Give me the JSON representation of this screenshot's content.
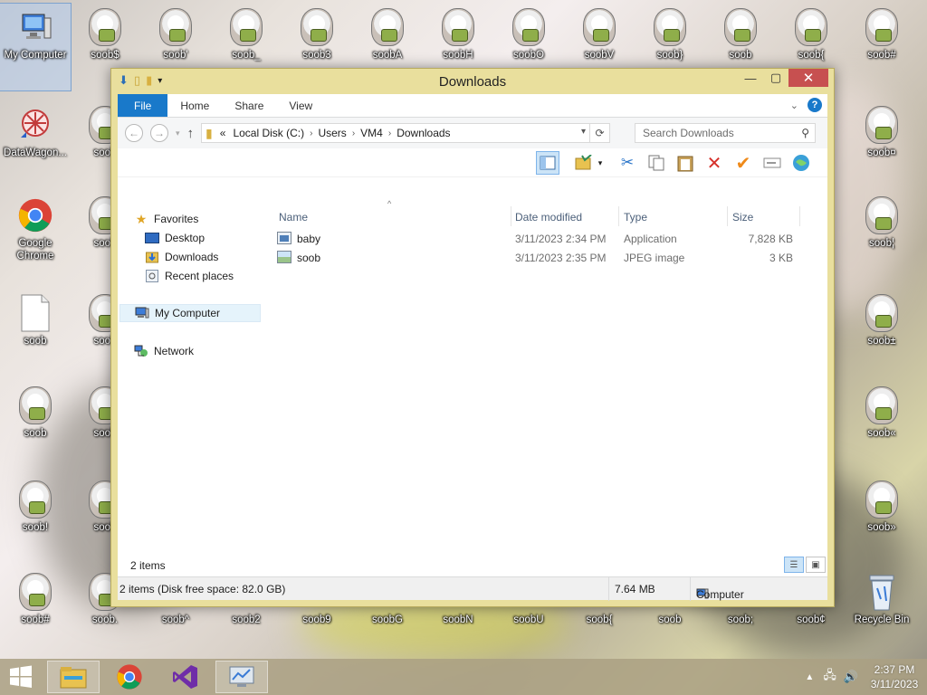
{
  "desktop": {
    "left_icons": [
      {
        "label": "My Computer"
      },
      {
        "label": "DataWagon..."
      },
      {
        "label": "Google Chrome"
      },
      {
        "label": "soob"
      },
      {
        "label": "soob"
      },
      {
        "label": "soob!"
      },
      {
        "label": "soob#"
      }
    ],
    "top_icons": [
      "soob$",
      "soob'",
      "soob_",
      "soob3",
      "soobA",
      "soobH",
      "soobO",
      "soobV",
      "soob}",
      "soob",
      "soob{",
      "soob#"
    ],
    "col2_icons": [
      "soob",
      "soob",
      "soob",
      "soob",
      "soob"
    ],
    "right_icons": [
      "soob¤",
      "soob¦",
      "soob±",
      "soob«",
      "soob»"
    ],
    "bottom_icons": [
      "soob.",
      "soob^",
      "soob2",
      "soob9",
      "soobG",
      "soobN",
      "soobU",
      "soob{",
      "soob",
      "soob;",
      "soob¢"
    ],
    "recycle_bin": "Recycle Bin"
  },
  "window": {
    "title": "Downloads",
    "ribbon_tabs": [
      "File",
      "Home",
      "Share",
      "View"
    ],
    "address": {
      "prefix": "«",
      "segments": [
        "Local Disk (C:)",
        "Users",
        "VM4",
        "Downloads"
      ]
    },
    "search_placeholder": "Search Downloads",
    "nav_pane": {
      "favorites": "Favorites",
      "desktop": "Desktop",
      "downloads": "Downloads",
      "recent": "Recent places",
      "computer": "My Computer",
      "network": "Network"
    },
    "columns": {
      "name": "Name",
      "date": "Date modified",
      "type": "Type",
      "size": "Size"
    },
    "files": [
      {
        "name": "baby",
        "date": "3/11/2023 2:34 PM",
        "type": "Application",
        "size": "7,828 KB"
      },
      {
        "name": "soob",
        "date": "3/11/2023 2:35 PM",
        "type": "JPEG image",
        "size": "3 KB"
      }
    ],
    "item_count": "2 items",
    "details": {
      "summary": "2 items (Disk free space: 82.0 GB)",
      "size": "7.64 MB",
      "location": "Computer"
    }
  },
  "taskbar": {
    "time": "2:37 PM",
    "date": "3/11/2023"
  },
  "colors": {
    "window_frame": "#e9df9d",
    "file_tab": "#1979ca",
    "close_button": "#c75050"
  }
}
